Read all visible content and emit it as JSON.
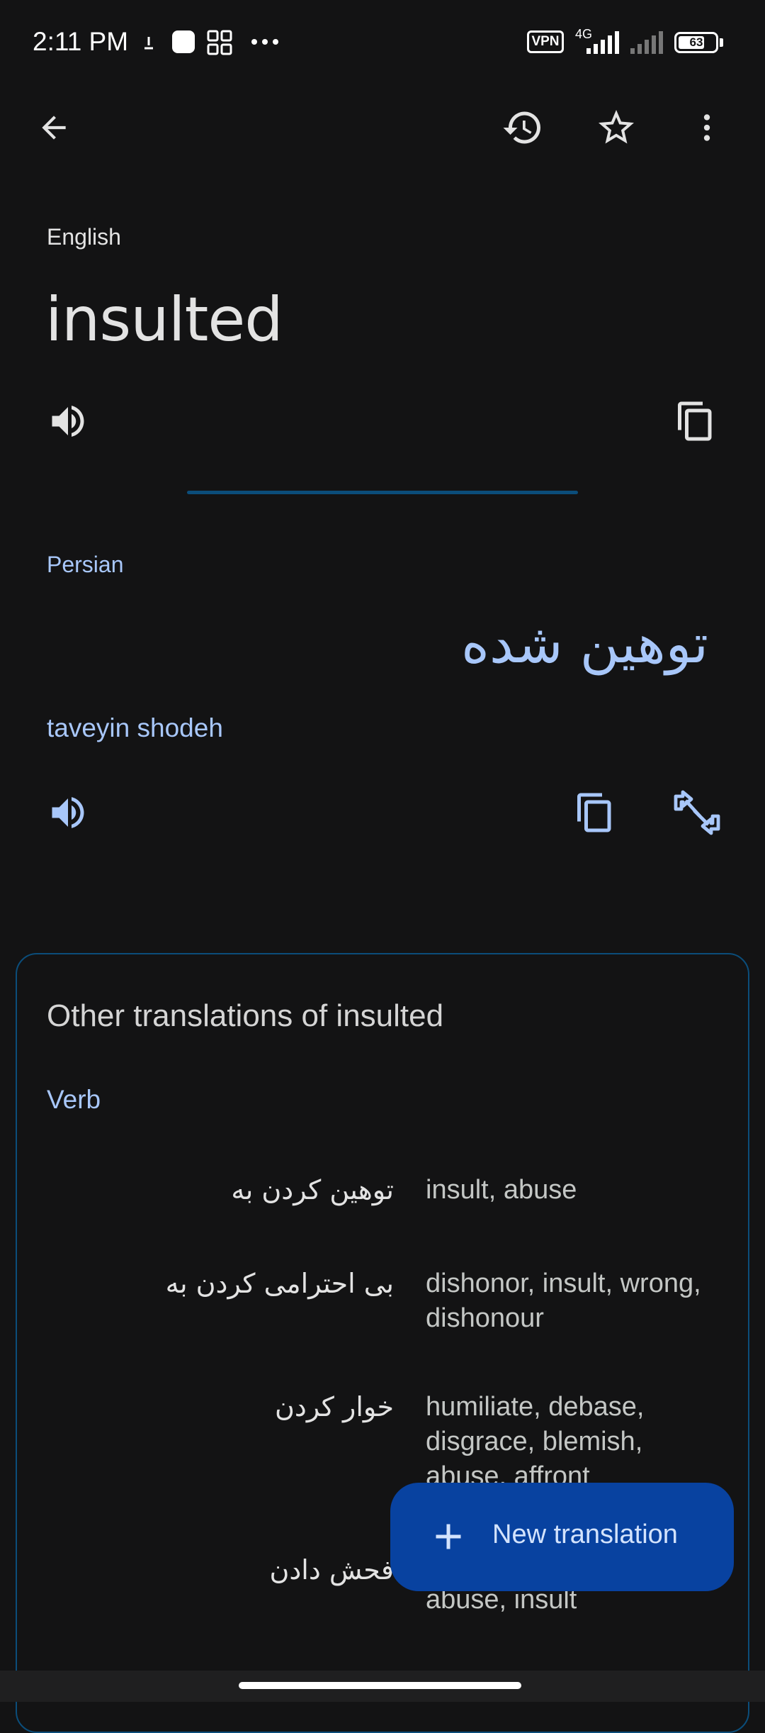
{
  "status_bar": {
    "time": "2:11 PM",
    "vpn_label": "VPN",
    "network_label": "4G",
    "battery_level": "63"
  },
  "toolbar": {
    "back_icon": "arrow-back-icon",
    "history_icon": "history-icon",
    "star_icon": "star-outline-icon",
    "more_icon": "more-vert-icon"
  },
  "source": {
    "language": "English",
    "text": "insulted"
  },
  "target": {
    "language": "Persian",
    "text": "توهین شده",
    "transliteration": "taveyin shodeh"
  },
  "other_translations": {
    "title": "Other translations of insulted",
    "part_of_speech": "Verb",
    "rows": [
      {
        "persian": "توهین کردن به",
        "english": "insult, abuse"
      },
      {
        "persian": "بی احترامی کردن به",
        "english": "dishonor, insult, wrong, dishonour"
      },
      {
        "persian": "خوار کردن",
        "english": "humiliate, debase, disgrace, blemish, abuse, affront"
      },
      {
        "persian": "فحش دادن",
        "english": "abuse, insult"
      }
    ]
  },
  "fab": {
    "label": "New translation",
    "icon": "plus-icon"
  },
  "colors": {
    "background": "#131314",
    "accent": "#a8c7fa",
    "fab": "#0842a0",
    "divider": "#0b4d7a"
  }
}
